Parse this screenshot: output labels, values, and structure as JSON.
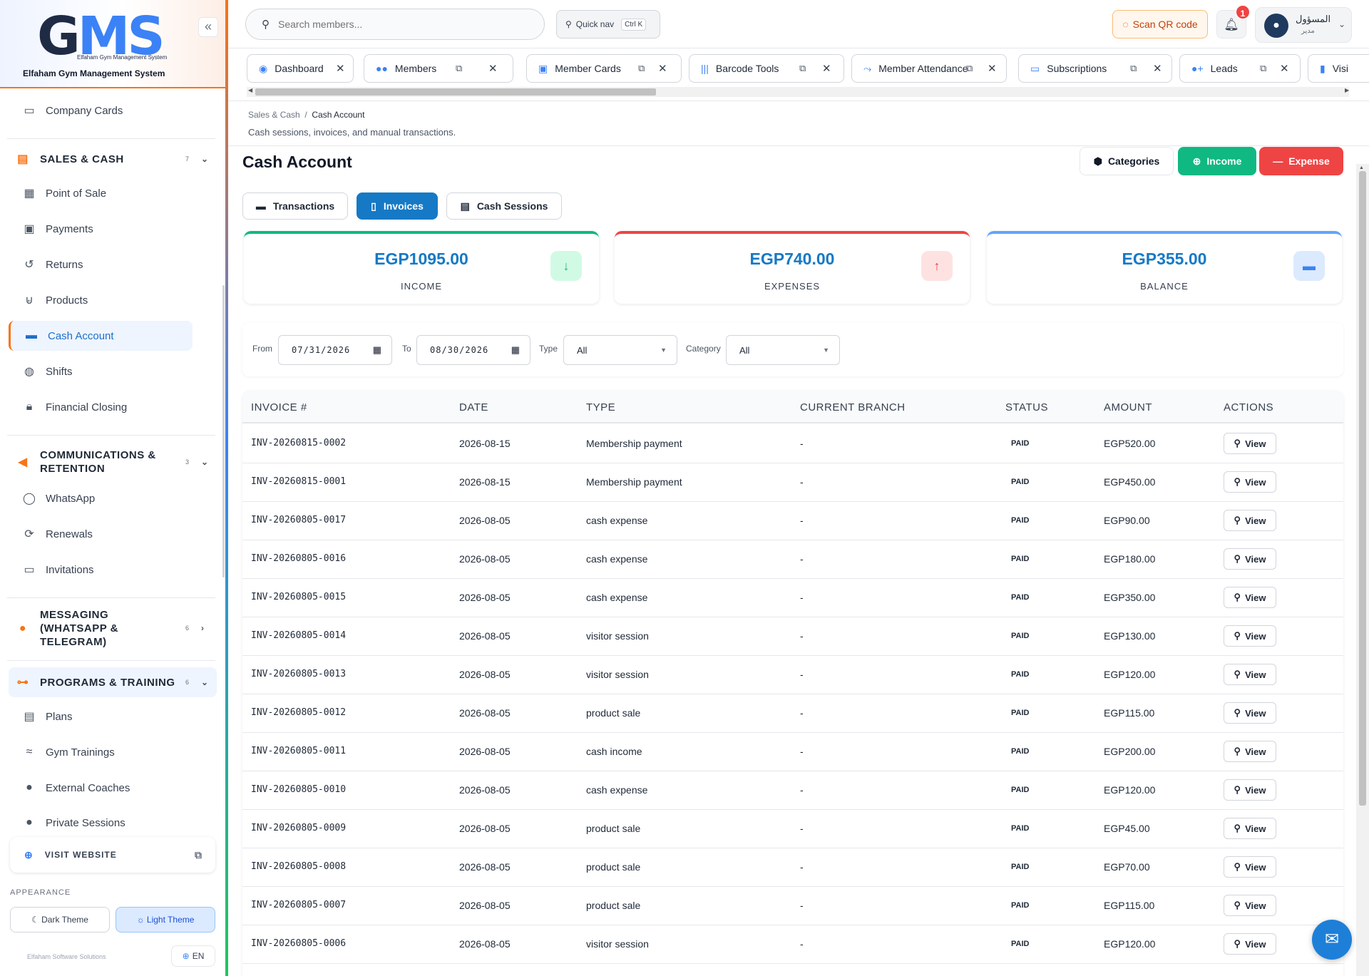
{
  "sidebar": {
    "logo_letters": "GMS",
    "logo_tagline": "Elfaham Gym Management System",
    "app_name": "Elfaham Gym Management System",
    "collapse_icon": "double-chevron-left-icon",
    "items": [
      {
        "label": "Company Cards",
        "icon": "id-card-icon"
      },
      {
        "label": "SALES & CASH",
        "count": "7",
        "section": true
      },
      {
        "label": "Point of Sale",
        "icon": "cash-register-icon"
      },
      {
        "label": "Payments",
        "icon": "money-icon"
      },
      {
        "label": "Returns",
        "icon": "undo-icon"
      },
      {
        "label": "Products",
        "icon": "basket-icon"
      },
      {
        "label": "Cash Account",
        "icon": "wallet-icon",
        "active": true
      },
      {
        "label": "Shifts",
        "icon": "shift-icon"
      },
      {
        "label": "Financial Closing",
        "icon": "lock-icon"
      },
      {
        "label": "COMMUNICATIONS & RETENTION",
        "count": "3",
        "section": true
      },
      {
        "label": "WhatsApp",
        "icon": "whatsapp-icon"
      },
      {
        "label": "Renewals",
        "icon": "refresh-icon"
      },
      {
        "label": "Invitations",
        "icon": "ticket-icon"
      },
      {
        "label": "MESSAGING (WHATSAPP & TELEGRAM)",
        "count": "6",
        "section": true
      },
      {
        "label": "PROGRAMS & TRAINING",
        "count": "6",
        "section": true
      },
      {
        "label": "Plans",
        "icon": "clipboard-icon"
      },
      {
        "label": "Gym Trainings",
        "icon": "exercise-icon"
      },
      {
        "label": "External Coaches",
        "icon": "coach-icon"
      },
      {
        "label": "Private Sessions",
        "icon": "user-clock-icon"
      }
    ],
    "visit_website": "VISIT WEBSITE",
    "appearance_label": "APPEARANCE",
    "dark_theme": "Dark Theme",
    "light_theme": "Light Theme",
    "footer": "Elfaham Software Solutions",
    "language": "EN"
  },
  "topbar": {
    "search_placeholder": "Search members...",
    "quick_nav": "Quick nav",
    "quick_nav_shortcut": "Ctrl K",
    "scan_qr": "Scan QR code",
    "notifications_count": "1",
    "user_name": "المسؤول",
    "user_role": "مدير"
  },
  "tabs": [
    {
      "label": "Dashboard",
      "icon": "dashboard-icon"
    },
    {
      "label": "Members",
      "icon": "users-icon"
    },
    {
      "label": "Member Cards",
      "icon": "id-card-icon"
    },
    {
      "label": "Barcode Tools",
      "icon": "barcode-icon"
    },
    {
      "label": "Member Attendance",
      "icon": "walking-icon"
    },
    {
      "label": "Subscriptions",
      "icon": "card-icon"
    },
    {
      "label": "Leads",
      "icon": "user-plus-icon"
    },
    {
      "label": "Visi",
      "icon": "door-icon"
    }
  ],
  "page": {
    "breadcrumb_parent": "Sales & Cash",
    "breadcrumb_current": "Cash Account",
    "description": "Cash sessions, invoices, and manual transactions.",
    "title": "Cash Account",
    "categories_btn": "Categories",
    "income_btn": "Income",
    "expense_btn": "Expense"
  },
  "subtabs": [
    {
      "label": "Transactions",
      "active": false
    },
    {
      "label": "Invoices",
      "active": true
    },
    {
      "label": "Cash Sessions",
      "active": false
    }
  ],
  "stats": {
    "income": {
      "value": "EGP1095.00",
      "label": "INCOME",
      "color": "#10b981"
    },
    "expenses": {
      "value": "EGP740.00",
      "label": "EXPENSES",
      "color": "#ef4444"
    },
    "balance": {
      "value": "EGP355.00",
      "label": "BALANCE",
      "color": "#60a5fa"
    }
  },
  "filters": {
    "from_label": "From",
    "from_value": "07/31/2026",
    "to_label": "To",
    "to_value": "08/30/2026",
    "type_label": "Type",
    "type_value": "All",
    "category_label": "Category",
    "category_value": "All"
  },
  "table": {
    "headers": [
      "INVOICE #",
      "DATE",
      "TYPE",
      "CURRENT BRANCH",
      "STATUS",
      "AMOUNT",
      "ACTIONS"
    ],
    "view_label": "View",
    "rows": [
      {
        "invoice": "INV-20260815-0002",
        "date": "2026-08-15",
        "type": "Membership payment",
        "branch": "-",
        "status": "PAID",
        "amount": "EGP520.00"
      },
      {
        "invoice": "INV-20260815-0001",
        "date": "2026-08-15",
        "type": "Membership payment",
        "branch": "-",
        "status": "PAID",
        "amount": "EGP450.00"
      },
      {
        "invoice": "INV-20260805-0017",
        "date": "2026-08-05",
        "type": "cash expense",
        "branch": "-",
        "status": "PAID",
        "amount": "EGP90.00"
      },
      {
        "invoice": "INV-20260805-0016",
        "date": "2026-08-05",
        "type": "cash expense",
        "branch": "-",
        "status": "PAID",
        "amount": "EGP180.00"
      },
      {
        "invoice": "INV-20260805-0015",
        "date": "2026-08-05",
        "type": "cash expense",
        "branch": "-",
        "status": "PAID",
        "amount": "EGP350.00"
      },
      {
        "invoice": "INV-20260805-0014",
        "date": "2026-08-05",
        "type": "visitor session",
        "branch": "-",
        "status": "PAID",
        "amount": "EGP130.00"
      },
      {
        "invoice": "INV-20260805-0013",
        "date": "2026-08-05",
        "type": "visitor session",
        "branch": "-",
        "status": "PAID",
        "amount": "EGP120.00"
      },
      {
        "invoice": "INV-20260805-0012",
        "date": "2026-08-05",
        "type": "product sale",
        "branch": "-",
        "status": "PAID",
        "amount": "EGP115.00"
      },
      {
        "invoice": "INV-20260805-0011",
        "date": "2026-08-05",
        "type": "cash income",
        "branch": "-",
        "status": "PAID",
        "amount": "EGP200.00"
      },
      {
        "invoice": "INV-20260805-0010",
        "date": "2026-08-05",
        "type": "cash expense",
        "branch": "-",
        "status": "PAID",
        "amount": "EGP120.00"
      },
      {
        "invoice": "INV-20260805-0009",
        "date": "2026-08-05",
        "type": "product sale",
        "branch": "-",
        "status": "PAID",
        "amount": "EGP45.00"
      },
      {
        "invoice": "INV-20260805-0008",
        "date": "2026-08-05",
        "type": "product sale",
        "branch": "-",
        "status": "PAID",
        "amount": "EGP70.00"
      },
      {
        "invoice": "INV-20260805-0007",
        "date": "2026-08-05",
        "type": "product sale",
        "branch": "-",
        "status": "PAID",
        "amount": "EGP115.00"
      },
      {
        "invoice": "INV-20260805-0006",
        "date": "2026-08-05",
        "type": "visitor session",
        "branch": "-",
        "status": "PAID",
        "amount": "EGP120.00"
      }
    ]
  }
}
